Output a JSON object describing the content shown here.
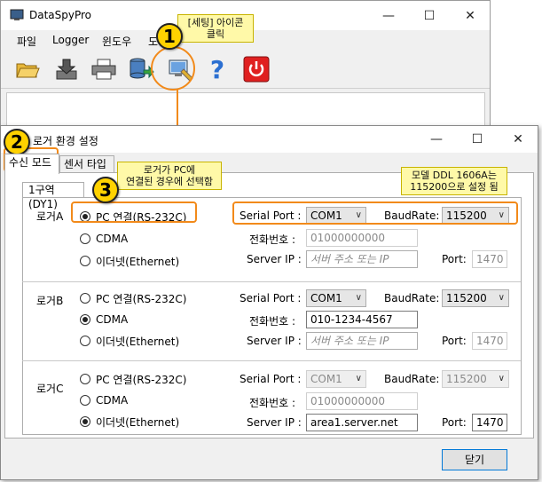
{
  "back_window": {
    "title": "DataSpyPro",
    "menu": [
      "파일",
      "Logger",
      "윈도우",
      "도"
    ],
    "toolbar_icons": [
      "open-folder-icon",
      "download-icon",
      "printer-icon",
      "database-icon",
      "settings-icon",
      "help-icon",
      "power-icon"
    ]
  },
  "settings_window": {
    "title": "로거 환경 설정",
    "tabs": [
      "수신 모드",
      "센서 타입"
    ],
    "region_tab": "1구역(DY1)",
    "close_button": "닫기",
    "loggers": [
      {
        "label": "로거A",
        "options": [
          "PC 연결(RS-232C)",
          "CDMA",
          "이더넷(Ethernet)"
        ],
        "selected": "PC 연결(RS-232C)",
        "serial_port_label": "Serial Port :",
        "serial_port": "COM1",
        "baudrate_label": "BaudRate:",
        "baudrate": "115200",
        "phone_label": "전화번호 :",
        "phone": "01000000000",
        "server_ip_label": "Server IP :",
        "server_ip": "서버 주소 또는 IP",
        "port_label": "Port:",
        "port": "1470"
      },
      {
        "label": "로거B",
        "options": [
          "PC 연결(RS-232C)",
          "CDMA",
          "이더넷(Ethernet)"
        ],
        "selected": "CDMA",
        "serial_port_label": "Serial Port :",
        "serial_port": "COM1",
        "baudrate_label": "BaudRate:",
        "baudrate": "115200",
        "phone_label": "전화번호 :",
        "phone": "010-1234-4567",
        "server_ip_label": "Server IP :",
        "server_ip": "서버 주소 또는 IP",
        "port_label": "Port:",
        "port": "1470"
      },
      {
        "label": "로거C",
        "options": [
          "PC 연결(RS-232C)",
          "CDMA",
          "이더넷(Ethernet)"
        ],
        "selected": "이더넷(Ethernet)",
        "serial_port_label": "Serial Port :",
        "serial_port": "COM1",
        "baudrate_label": "BaudRate:",
        "baudrate": "115200",
        "phone_label": "전화번호 :",
        "phone": "01000000000",
        "server_ip_label": "Server IP :",
        "server_ip": "area1.server.net",
        "port_label": "Port:",
        "port": "1470"
      }
    ]
  },
  "annotations": {
    "callout1": "[세팅] 아이콘\n클릭",
    "callout3": "로거가 PC에\n연결된 경우에 선택함",
    "callout_baud": "모델 DDL 1606A는\n115200으로 설정 됨",
    "badge1": "1",
    "badge2": "2",
    "badge3": "3",
    "accent": "#f28a1a",
    "callout_bg": "#fff9a8",
    "badge_bg": "#ffd200"
  }
}
